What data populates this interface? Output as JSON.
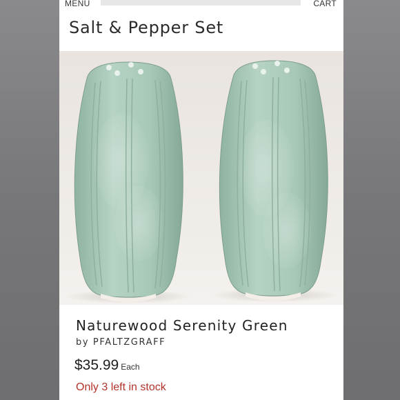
{
  "header": {
    "menu_label": "MENU",
    "cart_label": "CART"
  },
  "page_title": "Salt & Pepper Set",
  "product": {
    "name": "Naturewood Serenity Green",
    "byline": "by PFALTZGRAFF",
    "price": "$35.99",
    "price_unit": "Each",
    "stock_text": "Only 3 left in stock"
  },
  "colors": {
    "glaze": "#a9c9b8",
    "stock_alert": "#b3322a"
  }
}
